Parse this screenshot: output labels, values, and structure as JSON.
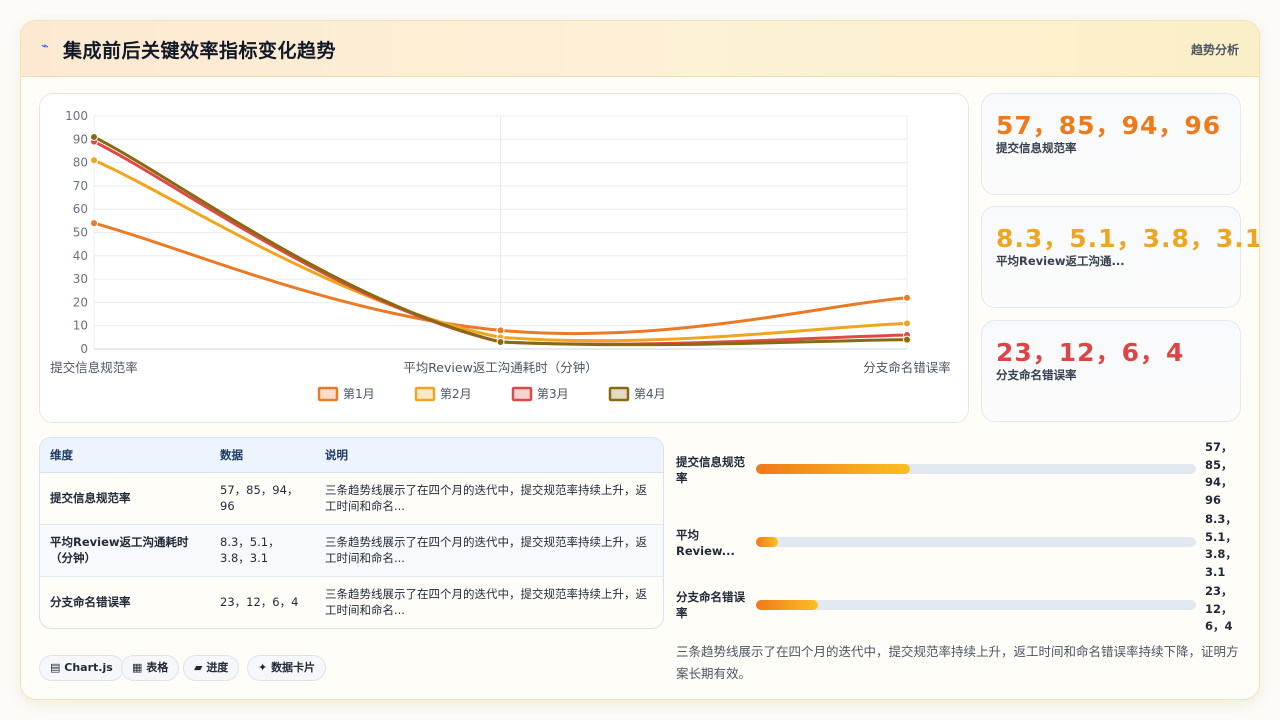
{
  "header": {
    "icon": "bolt-icon",
    "title": "集成前后关键效率指标变化趋势",
    "right_label": "趋势分析"
  },
  "chart_data": {
    "type": "line",
    "x": [
      "提交信息规范率",
      "平均Review返工沟通耗时（分钟）",
      "分支命名错误率"
    ],
    "ylim": [
      0,
      100
    ],
    "yticks": [
      0,
      10,
      20,
      30,
      40,
      50,
      60,
      70,
      80,
      90,
      100
    ],
    "grid": true,
    "legend_position": "bottom",
    "series": [
      {
        "name": "第1月",
        "color": "#ea7a26",
        "values": [
          54,
          8,
          22
        ]
      },
      {
        "name": "第2月",
        "color": "#f0a51f",
        "values": [
          81,
          5,
          11
        ]
      },
      {
        "name": "第3月",
        "color": "#dd4b47",
        "values": [
          89,
          3,
          6
        ]
      },
      {
        "name": "第4月",
        "color": "#8a6a10",
        "values": [
          91,
          3,
          4
        ]
      }
    ]
  },
  "kpis": [
    {
      "value": "57，85，94，96",
      "label": "提交信息规范率",
      "color": "#f07a1a"
    },
    {
      "value": "8.3，5.1，3.8，3.1",
      "label": "平均Review返工沟通...",
      "color": "#f0a51f"
    },
    {
      "value": "23，12，6，4",
      "label": "分支命名错误率",
      "color": "#dd4444"
    }
  ],
  "table": {
    "headers": [
      "维度",
      "数据",
      "说明"
    ],
    "rows": [
      {
        "dim": "提交信息规范率",
        "data": "57，85，94，96",
        "desc": "三条趋势线展示了在四个月的迭代中，提交规范率持续上升，返工时间和命名..."
      },
      {
        "dim": "平均Review返工沟通耗时（分钟）",
        "data": "8.3，5.1，3.8，3.1",
        "desc": "三条趋势线展示了在四个月的迭代中，提交规范率持续上升，返工时间和命名..."
      },
      {
        "dim": "分支命名错误率",
        "data": "23，12，6，4",
        "desc": "三条趋势线展示了在四个月的迭代中，提交规范率持续上升，返工时间和命名..."
      }
    ]
  },
  "chips": [
    {
      "icon": "chart-icon",
      "glyph": "▤",
      "label": "Chart.js"
    },
    {
      "icon": "table-icon",
      "glyph": "▦",
      "label": "表格"
    },
    {
      "icon": "progress-icon",
      "glyph": "▰",
      "label": "进度"
    },
    {
      "icon": "card-icon",
      "glyph": "✦",
      "label": "数据卡片"
    }
  ],
  "progress": [
    {
      "label": "提交信息规范率",
      "value": "57，85，94，96",
      "fraction": 0.35
    },
    {
      "label": "平均Review...",
      "value": "8.3，5.1，3.8，3.1",
      "fraction": 0.05
    },
    {
      "label": "分支命名错误率",
      "value": "23，12，6，4",
      "fraction": 0.14
    }
  ],
  "summary": "三条趋势线展示了在四个月的迭代中，提交规范率持续上升，返工时间和命名错误率持续下降，证明方案长期有效。"
}
